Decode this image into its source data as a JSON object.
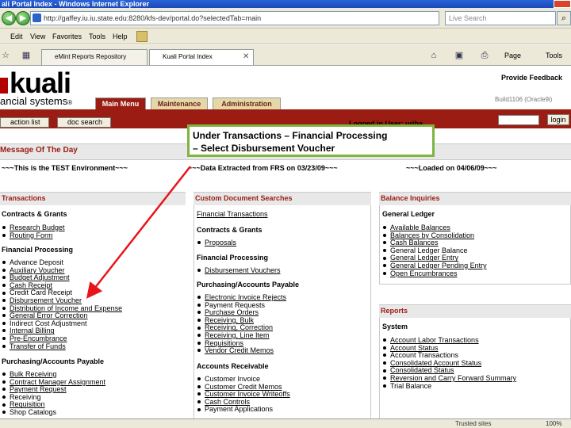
{
  "window": {
    "title": "ali Portal Index - Windows Internet Explorer",
    "address": "http://gaffey.iu.iu.state.edu:8280/kfs-dev/portal.do?selectedTab=main",
    "search_placeholder": "Live Search",
    "menu": [
      "Edit",
      "View",
      "Favorites",
      "Tools",
      "Help"
    ],
    "tabs": [
      "eMint Reports Repository",
      "Kuali Portal Index"
    ],
    "toolbar_right": [
      "Page",
      "Tools"
    ],
    "status": {
      "zone": "Trusted sites",
      "zoom": "100%"
    }
  },
  "header": {
    "logo": "kuali",
    "logo_sub": "ancial systems",
    "trademark": "®",
    "tabs": [
      "Main Menu",
      "Maintenance",
      "Administration"
    ],
    "provide_feedback": "Provide Feedback",
    "build": "Build1106 (Oracle9i)",
    "buttons": {
      "action_list": "action list",
      "doc_search": "doc search"
    },
    "logged_in": "Logged in User: uriba",
    "login_button": "login"
  },
  "message": {
    "title": "Message Of The Day",
    "env": "~~~This is the TEST Environment~~~",
    "extracted": "~~~Data Extracted from FRS on 03/23/09~~~",
    "loaded": "~~~Loaded on 04/06/09~~~"
  },
  "callout": {
    "line1": "Under Transactions – Financial Processing",
    "line2": "– Select Disbursement Voucher",
    "color": "#7db540"
  },
  "transactions": {
    "heading": "Transactions",
    "sections": [
      {
        "title": "Contracts & Grants",
        "items": [
          "Research Budget",
          "Routing Form"
        ]
      },
      {
        "title": "Financial Processing",
        "items": [
          "Advance Deposit",
          "Auxiliary Voucher",
          "Budget Adjustment",
          "Cash Receipt",
          "Credit Card Receipt",
          "Disbursement Voucher",
          "Distribution of Income and Expense",
          "General Error Correction",
          "Indirect Cost Adjustment",
          "Internal Billing",
          "Pre-Encumbrance",
          "Transfer of Funds"
        ]
      },
      {
        "title": "Purchasing/Accounts Payable",
        "items": [
          "Bulk Receiving",
          "Contract Manager Assignment",
          "Payment Request",
          "Receiving",
          "Requisition",
          "Shop Catalogs"
        ]
      }
    ]
  },
  "custom": {
    "heading": "Custom Document Searches",
    "top_link": "Financial Transactions",
    "sections": [
      {
        "title": "Contracts & Grants",
        "items": [
          "Proposals"
        ]
      },
      {
        "title": "Financial Processing",
        "items": [
          "Disbursement Vouchers"
        ]
      },
      {
        "title": "Purchasing/Accounts Payable",
        "items": [
          "Electronic Invoice Rejects",
          "Payment Requests",
          "Purchase Orders",
          "Receiving, Bulk",
          "Receiving, Correction",
          "Receiving, Line Item",
          "Requisitions",
          "Vendor Credit Memos"
        ]
      },
      {
        "title": "Accounts Receivable",
        "items": [
          "Customer Invoice",
          "Customer Credit Memos",
          "Customer Invoice Writeoffs",
          "Cash Controls",
          "Payment Applications"
        ]
      }
    ]
  },
  "balance": {
    "heading": "Balance Inquiries",
    "sections": [
      {
        "title": "General Ledger",
        "items": [
          "Available Balances",
          "Balances by Consolidation",
          "Cash Balances",
          "General Ledger Balance",
          "General Ledger Entry",
          "General Ledger Pending Entry",
          "Open Encumbrances"
        ]
      }
    ]
  },
  "reports": {
    "heading": "Reports",
    "sections": [
      {
        "title": "System",
        "items": [
          "Account Labor Transactions",
          "Account Status",
          "Account Transactions",
          "Consolidated Account Status",
          "Consolidated Status",
          "Reversion and Carry Forward Summary",
          "Trial Balance"
        ]
      }
    ]
  }
}
